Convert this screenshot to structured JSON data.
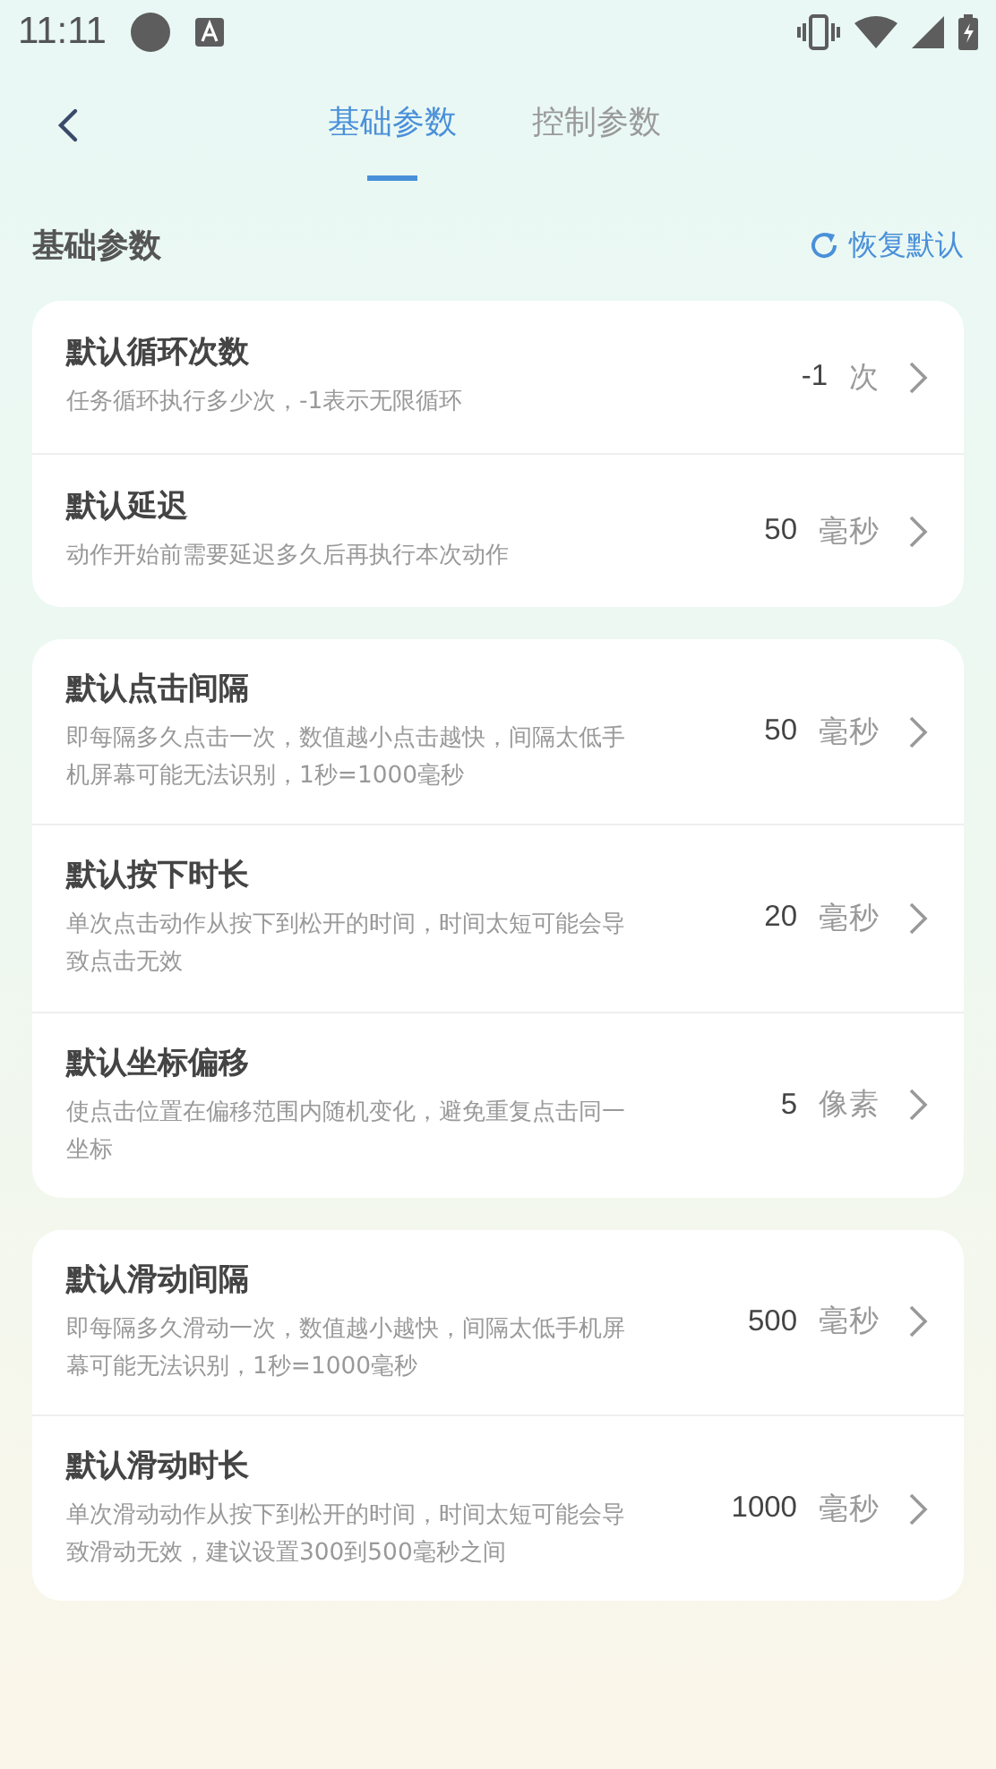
{
  "status_bar": {
    "time": "11:11"
  },
  "header": {
    "tabs": [
      {
        "label": "基础参数",
        "selected": true
      },
      {
        "label": "控制参数",
        "selected": false
      }
    ]
  },
  "section": {
    "title": "基础参数",
    "reset_label": "恢复默认"
  },
  "groups": [
    {
      "items": [
        {
          "title": "默认循环次数",
          "description": "任务循环执行多少次，-1表示无限循环",
          "value": "-1",
          "unit": "次"
        },
        {
          "title": "默认延迟",
          "description": "动作开始前需要延迟多久后再执行本次动作",
          "value": "50",
          "unit": "毫秒"
        }
      ]
    },
    {
      "items": [
        {
          "title": "默认点击间隔",
          "description": "即每隔多久点击一次，数值越小点击越快，间隔太低手机屏幕可能无法识别，1秒=1000毫秒",
          "value": "50",
          "unit": "毫秒"
        },
        {
          "title": "默认按下时长",
          "description": "单次点击动作从按下到松开的时间，时间太短可能会导致点击无效",
          "value": "20",
          "unit": "毫秒"
        },
        {
          "title": "默认坐标偏移",
          "description": "使点击位置在偏移范围内随机变化，避免重复点击同一坐标",
          "value": "5",
          "unit": "像素"
        }
      ]
    },
    {
      "items": [
        {
          "title": "默认滑动间隔",
          "description": "即每隔多久滑动一次，数值越小越快，间隔太低手机屏幕可能无法识别，1秒=1000毫秒",
          "value": "500",
          "unit": "毫秒"
        },
        {
          "title": "默认滑动时长",
          "description": "单次滑动动作从按下到松开的时间，时间太短可能会导致滑动无效，建议设置300到500毫秒之间",
          "value": "1000",
          "unit": "毫秒"
        }
      ]
    }
  ]
}
